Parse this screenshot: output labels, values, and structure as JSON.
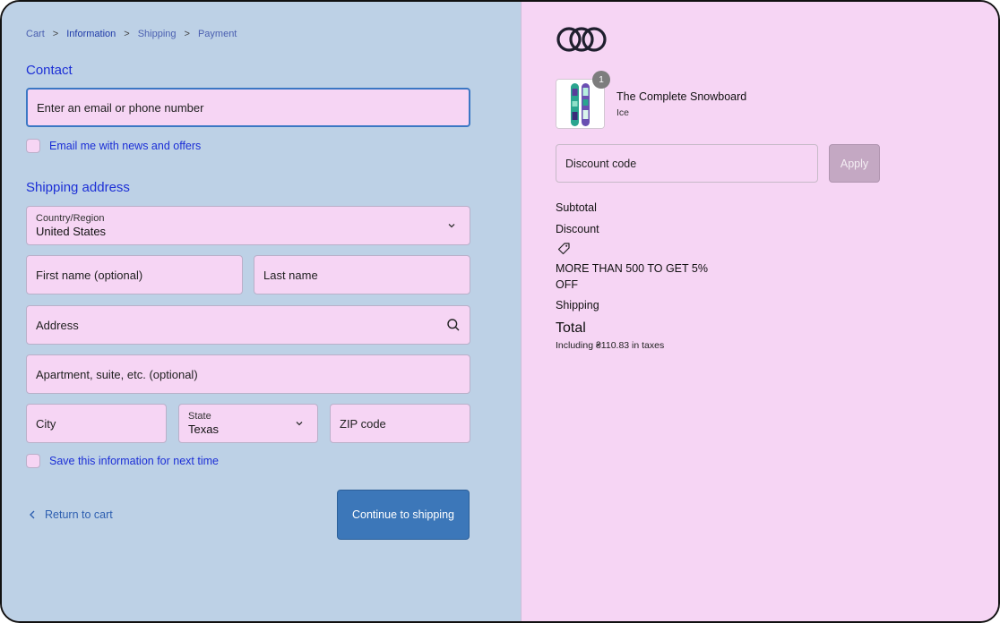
{
  "breadcrumb": {
    "items": [
      "Cart",
      "Information",
      "Shipping",
      "Payment"
    ],
    "separator": ">"
  },
  "contact": {
    "title": "Contact",
    "email_placeholder": "Enter an email or phone number",
    "news_checkbox_label": "Email me with news and offers"
  },
  "shipping": {
    "title": "Shipping address",
    "country_label": "Country/Region",
    "country_value": "United States",
    "first_name_placeholder": "First name (optional)",
    "last_name_placeholder": "Last name",
    "address_placeholder": "Address",
    "apartment_placeholder": "Apartment, suite, etc. (optional)",
    "city_placeholder": "City",
    "state_label": "State",
    "state_value": "Texas",
    "zip_placeholder": "ZIP code",
    "save_checkbox_label": "Save this information for next time"
  },
  "actions": {
    "return_label": "Return to cart",
    "continue_label": "Continue to shipping"
  },
  "summary": {
    "product": {
      "name": "The Complete Snowboard",
      "variant": "Ice",
      "quantity": "1"
    },
    "discount_placeholder": "Discount code",
    "apply_label": "Apply",
    "subtotal_label": "Subtotal",
    "discount_label": "Discount",
    "discount_code": "MORE THAN 500 TO GET 5% OFF",
    "shipping_label": "Shipping",
    "total_label": "Total",
    "tax_note": "Including ₴110.83 in taxes"
  },
  "colors": {
    "left_bg": "#bdd1e6",
    "right_bg": "#f6d5f4",
    "accent": "#3c77b9",
    "link": "#1c2fd6"
  },
  "icons": {
    "logo": "interlocking-rings-logo",
    "search": "search-icon",
    "chevron": "chevron-down-icon",
    "tag": "tag-icon",
    "back": "chevron-left-icon"
  }
}
